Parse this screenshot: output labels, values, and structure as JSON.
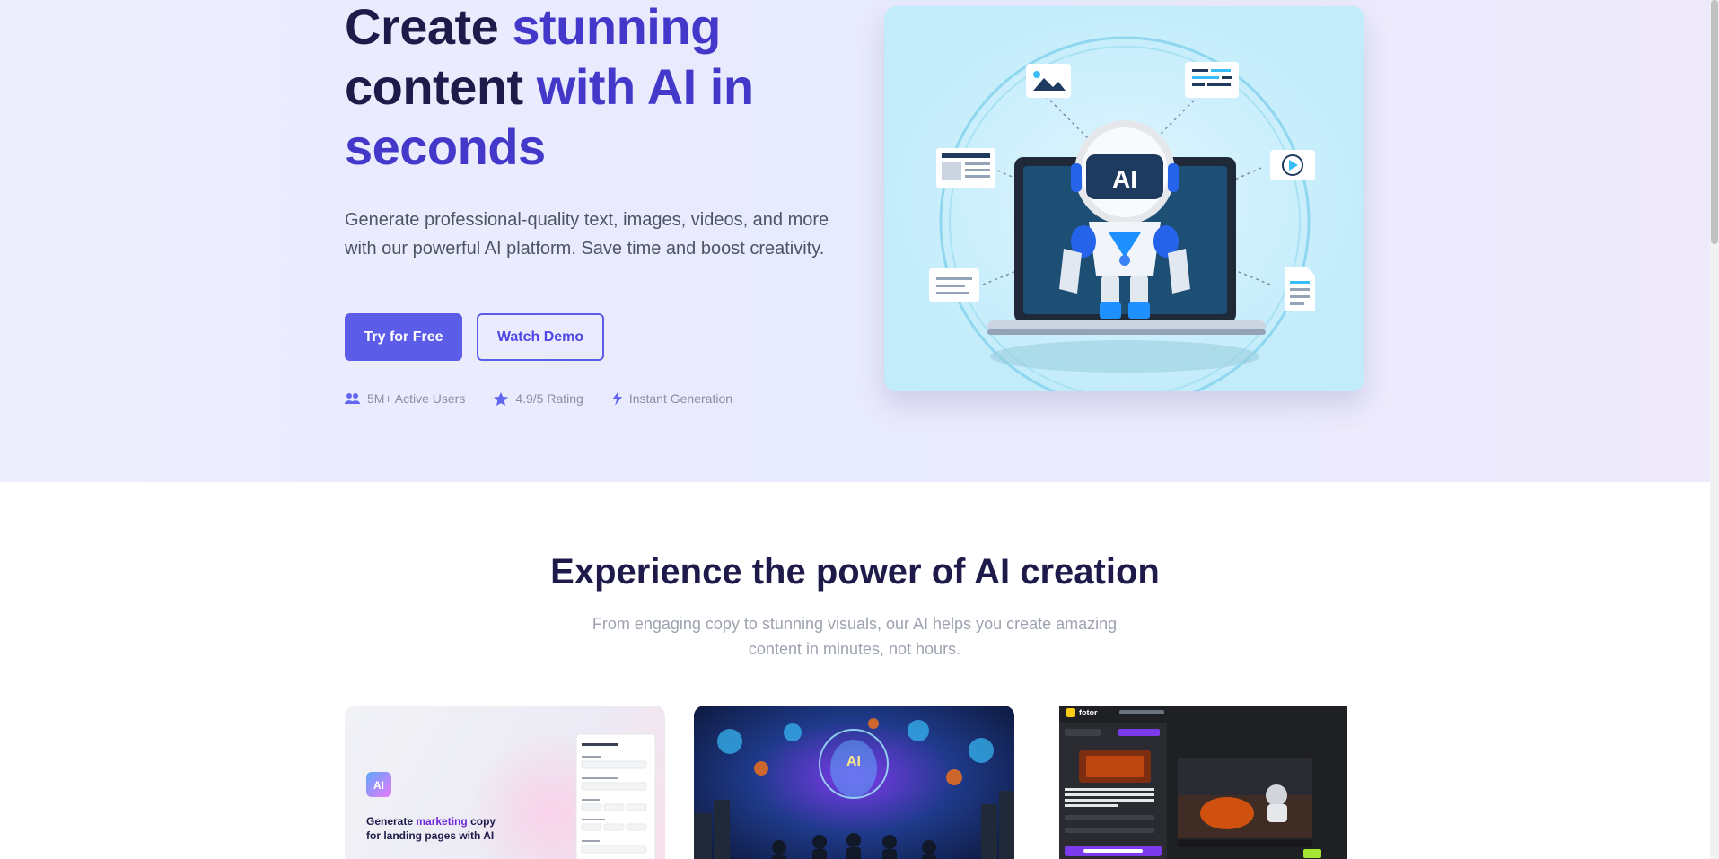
{
  "hero": {
    "title_line1_a": "Create",
    "title_line1_b": "stunning",
    "title_line2_a": "content",
    "title_line2_b": "with AI in",
    "title_line3": "seconds",
    "subtitle": "Generate professional-quality text, images, videos, and more with our powerful AI platform. Save time and boost creativity.",
    "primary_button": "Try for Free",
    "secondary_button": "Watch Demo",
    "stats": [
      {
        "icon": "users-icon",
        "label": "5M+ Active Users"
      },
      {
        "icon": "star-icon",
        "label": "4.9/5 Rating"
      },
      {
        "icon": "bolt-icon",
        "label": "Instant Generation"
      }
    ],
    "illustration_badge": "AI"
  },
  "features": {
    "title": "Experience the power of AI creation",
    "subtitle": "From engaging copy to stunning visuals, our AI helps you create amazing content in minutes, not hours.",
    "cards": [
      {
        "badge": "AI",
        "caption_a": "Generate ",
        "caption_highlight": "marketing",
        "caption_b": " copy for landing pages with AI"
      },
      {
        "badge": "AI"
      },
      {
        "brand": "fotor"
      }
    ]
  },
  "colors": {
    "accent": "#5b5ce8",
    "heading": "#1e1b4b",
    "accent_text": "#4338ca"
  }
}
